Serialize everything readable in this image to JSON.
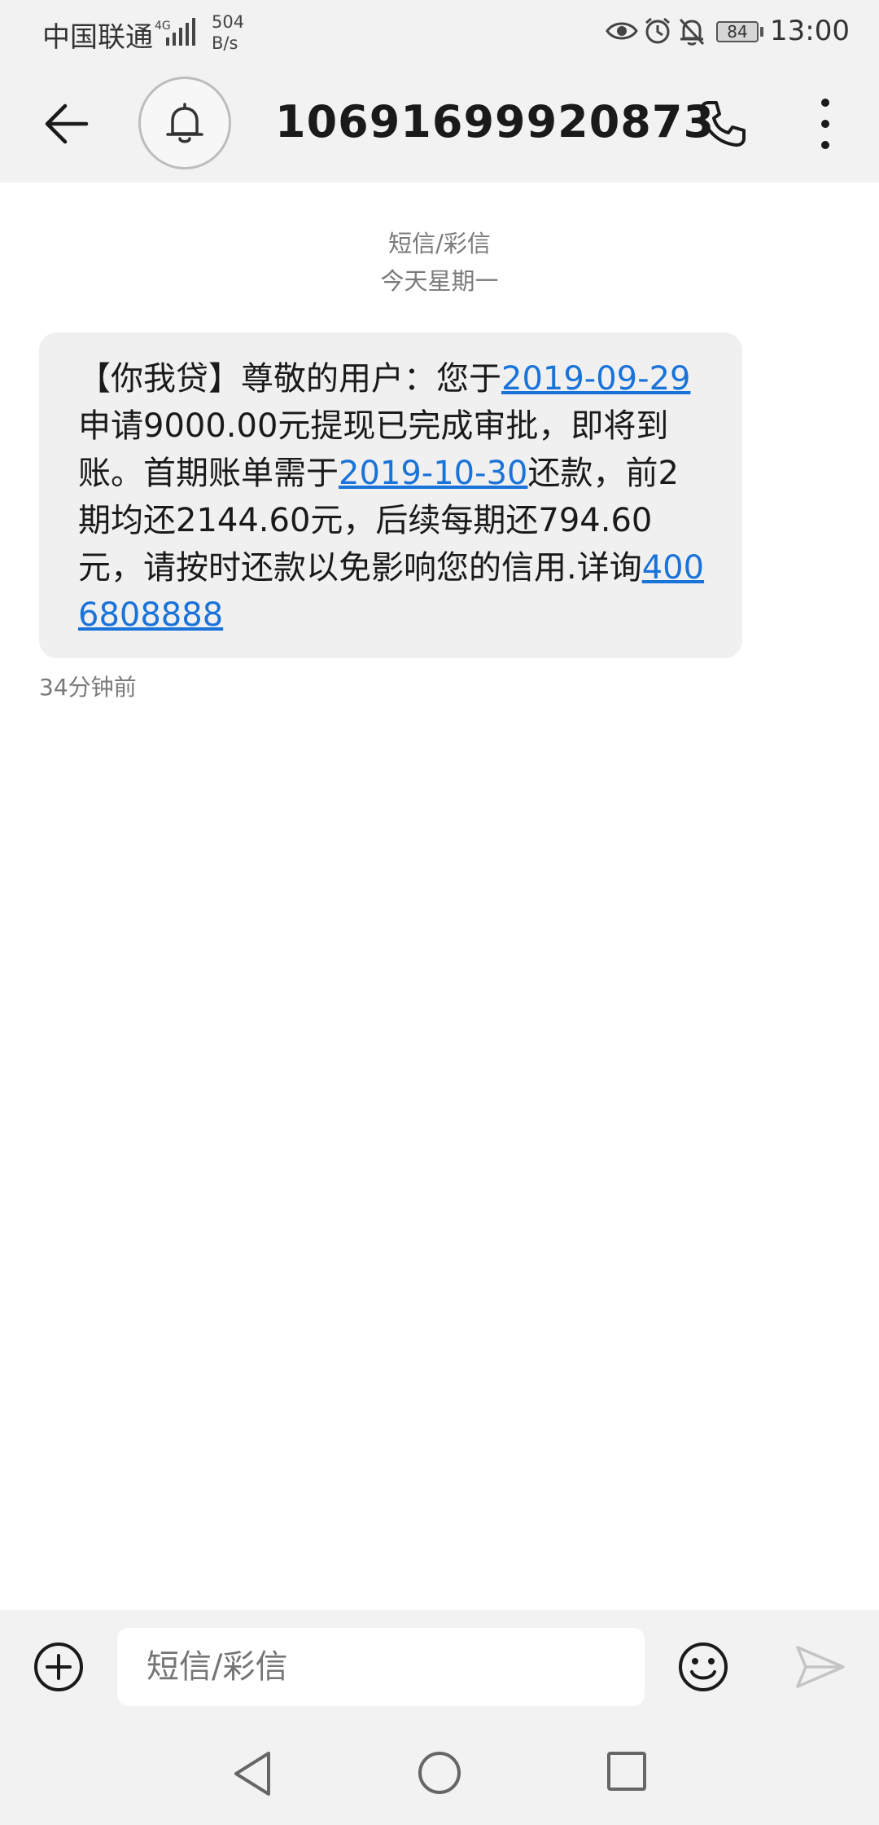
{
  "status_bar": {
    "carrier": "中国联通",
    "network_label": "4G",
    "net_speed_value": "504",
    "net_speed_unit": "B/s",
    "battery": "84",
    "time": "13:00",
    "icons": [
      "signal-icon",
      "eye-icon",
      "alarm-icon",
      "mute-bell-icon",
      "battery-icon"
    ]
  },
  "header": {
    "contact": "10691699920873",
    "icons": [
      "back-arrow-icon",
      "bell-icon",
      "phone-icon",
      "more-vertical-icon"
    ]
  },
  "conversation": {
    "type_label": "短信/彩信",
    "date_label": "今天星期一",
    "message": {
      "segments": [
        {
          "text": "【你我贷】尊敬的用户：您于",
          "link": false
        },
        {
          "text": "2019-09-29",
          "link": true
        },
        {
          "text": "申请9000.00元提现已完成审批，即将到账。首期账单需于",
          "link": false
        },
        {
          "text": "2019-10-30",
          "link": true
        },
        {
          "text": "还款，前2期均还2144.60元，后续每期还794.60元，请按时还款以免影响您的信用.详询",
          "link": false
        },
        {
          "text": "4006808888",
          "link": true
        }
      ],
      "time": "34分钟前"
    }
  },
  "composer": {
    "placeholder": "短信/彩信",
    "icons": [
      "add-circle-icon",
      "emoji-icon",
      "send-icon"
    ]
  },
  "nav_bar": {
    "icons": [
      "nav-back-icon",
      "nav-home-icon",
      "nav-recent-icon"
    ]
  },
  "colors": {
    "link": "#1a73d9",
    "bar_background": "#f2f2f2",
    "bubble_background": "#f0f0f0"
  }
}
